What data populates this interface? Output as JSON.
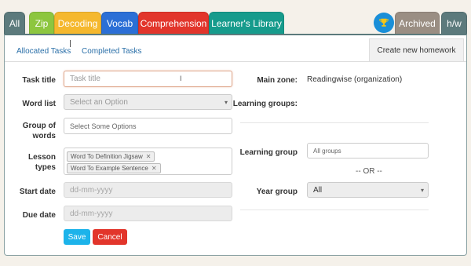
{
  "tabs": [
    {
      "label": "All",
      "color": "#5c7a7c"
    },
    {
      "label": "Zip",
      "color": "#8dc63f"
    },
    {
      "label": "Decoding",
      "color": "#f5b82e"
    },
    {
      "label": "Vocab",
      "color": "#2b6fd6"
    },
    {
      "label": "Comprehension",
      "color": "#e2352b"
    },
    {
      "label": "Learner's Library",
      "color": "#169b8c"
    }
  ],
  "right_tabs": {
    "archived": "Archived",
    "hw": "h/w",
    "trophy_icon": "trophy-icon"
  },
  "subtabs": {
    "allocated": "Allocated Tasks",
    "completed": "Completed Tasks",
    "create": "Create new homework"
  },
  "form": {
    "task_title": {
      "label": "Task title",
      "placeholder": "Task title"
    },
    "word_list": {
      "label": "Word list",
      "value": "Select an Option"
    },
    "group_of_words": {
      "label_line1": "Group of",
      "label_line2": "words",
      "placeholder": "Select Some Options"
    },
    "lesson_types": {
      "label": "Lesson types",
      "chips": [
        "Word To Definition Jigsaw",
        "Word To Example Sentence"
      ]
    },
    "start_date": {
      "label": "Start date",
      "placeholder": "dd-mm-yyyy"
    },
    "due_date": {
      "label": "Due date",
      "placeholder": "dd-mm-yyyy"
    },
    "save": "Save",
    "cancel": "Cancel"
  },
  "right": {
    "main_zone_label": "Main zone:",
    "main_zone_value": "Readingwise",
    "main_zone_suffix": "(organization)",
    "learning_groups_label": "Learning groups:",
    "learning_group_label": "Learning group",
    "learning_group_placeholder": "All groups",
    "or_text": "-- OR --",
    "year_group_label": "Year group",
    "year_group_value": "All"
  },
  "colors": {
    "save": "#1cb3ea",
    "cancel": "#e2352b",
    "link": "#2a6fa8"
  }
}
